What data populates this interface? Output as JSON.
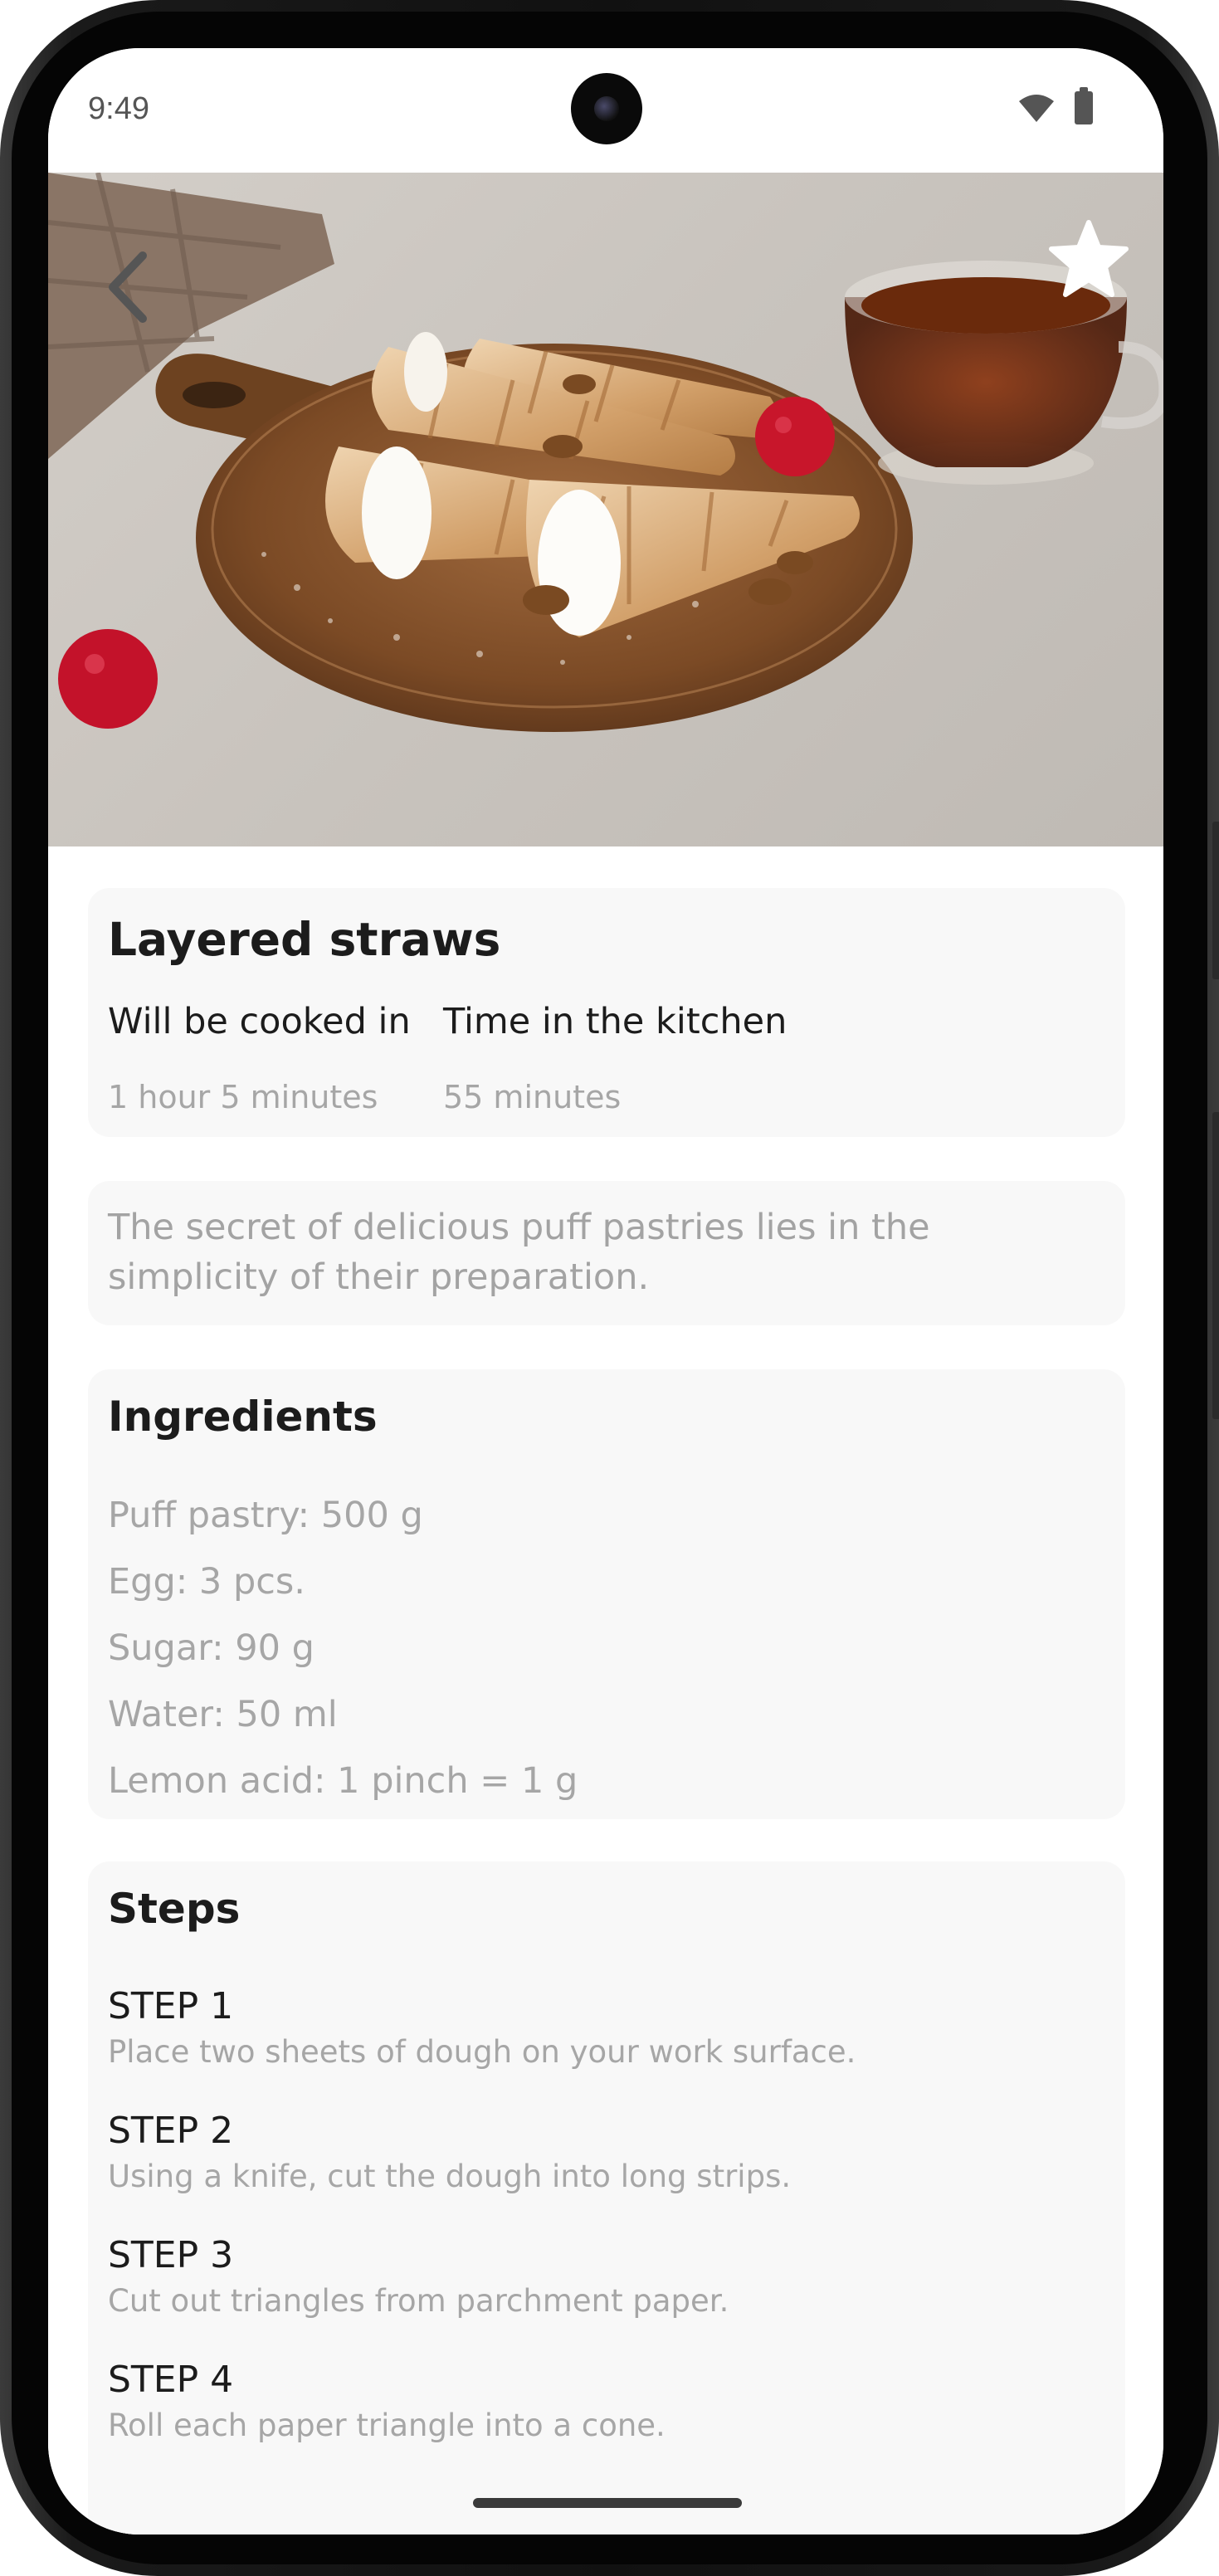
{
  "status_bar": {
    "time": "9:49"
  },
  "recipe": {
    "title": "Layered straws",
    "stats": [
      {
        "label": "Will be cooked in",
        "value": "1 hour 5 minutes"
      },
      {
        "label": "Time in the kitchen",
        "value": "55 minutes"
      }
    ],
    "description": "The secret of delicious puff pastries lies in the simplicity of their preparation."
  },
  "ingredients": {
    "title": "Ingredients",
    "items": [
      "Puff pastry: 500 g",
      "Egg: 3 pcs.",
      "Sugar: 90 g",
      "Water: 50 ml",
      "Lemon acid: 1 pinch = 1 g"
    ]
  },
  "steps": {
    "title": "Steps",
    "items": [
      {
        "title": "STEP 1",
        "text": "Place two sheets of dough on your work surface."
      },
      {
        "title": "STEP 2",
        "text": "Using a knife, cut the dough into long strips."
      },
      {
        "title": "STEP 3",
        "text": "Cut out triangles from parchment paper."
      },
      {
        "title": "STEP 4",
        "text": "Roll each paper triangle into a cone."
      }
    ]
  },
  "icons": {
    "back": "chevron-left-icon",
    "favorite": "star-icon",
    "wifi": "wifi-icon",
    "battery": "battery-icon"
  },
  "colors": {
    "card_background": "#f8f8f8",
    "primary_text": "#1c1c1c",
    "secondary_text": "#a6a6a6",
    "icon_overlay": "#ffffff"
  }
}
